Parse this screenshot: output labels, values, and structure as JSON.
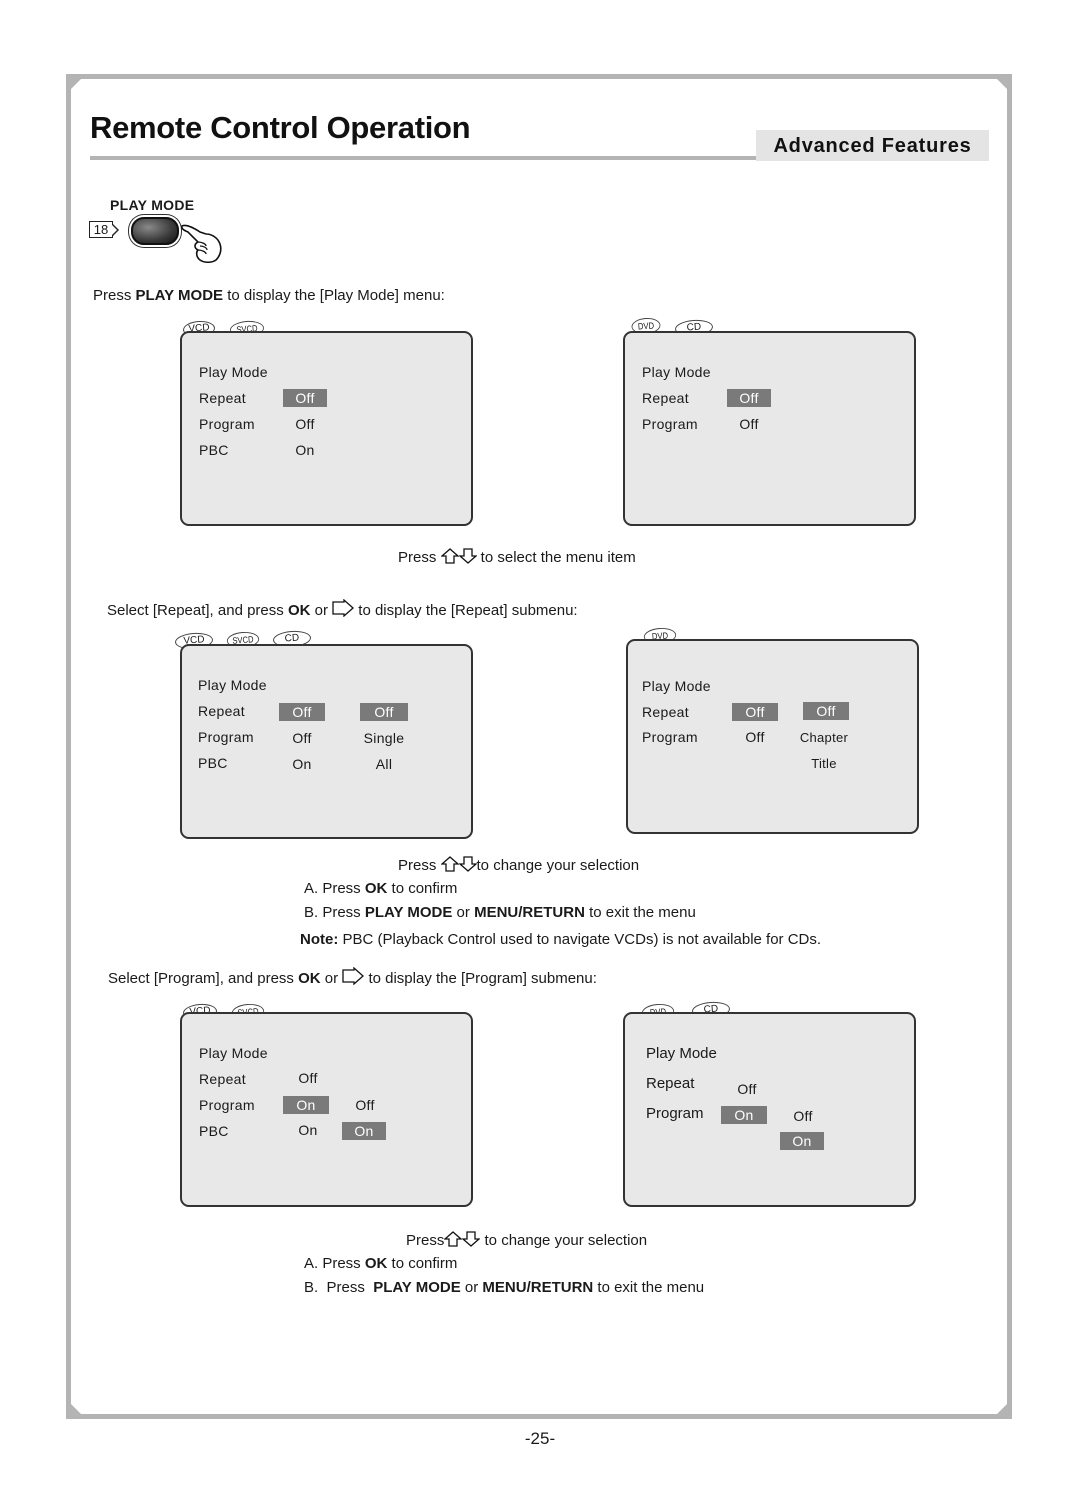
{
  "header": {
    "title": "Remote Control Operation",
    "section": "Advanced Features"
  },
  "button": {
    "label": "PLAY MODE",
    "key_number": "18"
  },
  "step1": {
    "pre": "Press ",
    "bold": "PLAY MODE",
    "post": " to display the [Play Mode] menu:"
  },
  "menus_main": {
    "left": {
      "tabs": [
        "VCD",
        "SVCD"
      ],
      "title": "Play Mode",
      "rows": [
        {
          "label": "Repeat",
          "value": "Off",
          "selected": true
        },
        {
          "label": "Program",
          "value": "Off"
        },
        {
          "label": "PBC",
          "value": "On"
        }
      ]
    },
    "right": {
      "tabs": [
        "DVD",
        "CD"
      ],
      "title": "Play Mode",
      "rows": [
        {
          "label": "Repeat",
          "value": "Off",
          "selected": true
        },
        {
          "label": "Program",
          "value": "Off"
        }
      ]
    }
  },
  "hint_select": {
    "pre": "Press",
    "post": " to select the menu item"
  },
  "step2": {
    "pre": "Select [Repeat], and press ",
    "bold": "OK",
    "mid": " or ",
    "post": " to display the [Repeat] submenu:"
  },
  "menus_repeat": {
    "left": {
      "tabs": [
        "VCD",
        "SVCD",
        "CD"
      ],
      "title": "Play Mode",
      "rows": [
        {
          "label": "Repeat",
          "value": "Off"
        },
        {
          "label": "Program",
          "value": "Off"
        },
        {
          "label": "PBC",
          "value": "On"
        }
      ],
      "submenu": [
        "Off",
        "Single",
        "All"
      ],
      "submenu_selected": "Off"
    },
    "right": {
      "tabs": [
        "DVD"
      ],
      "title": "Play Mode",
      "rows": [
        {
          "label": "Repeat",
          "value": "Off"
        },
        {
          "label": "Program",
          "value": "Off"
        }
      ],
      "submenu": [
        "Off",
        "Chapter",
        "Title"
      ],
      "submenu_selected": "Off"
    }
  },
  "instructions_repeat": {
    "change_pre": "Press",
    "change_post": "to change your selection",
    "a_prefix": "A.  Press ",
    "a_bold": "OK",
    "a_post": " to confirm",
    "b_prefix": "B.  Press ",
    "b_bold1": "PLAY MODE",
    "b_mid": " or ",
    "b_bold2": "MENU/RETURN",
    "b_post": " to exit the menu",
    "note_label": "Note:",
    "note_text": " PBC (Playback Control used to navigate VCDs) is not available for CDs."
  },
  "step3": {
    "pre": "Select [Program], and press ",
    "bold": "OK",
    "mid": " or ",
    "post": " to display the [Program] submenu:"
  },
  "menus_program": {
    "left": {
      "tabs": [
        "VCD",
        "SVCD"
      ],
      "title": "Play Mode",
      "rows": [
        {
          "label": "Repeat",
          "value": "Off"
        },
        {
          "label": "Program",
          "value": "On",
          "selected": true
        },
        {
          "label": "PBC",
          "value": "On"
        }
      ],
      "submenu": [
        "Off",
        "On"
      ],
      "submenu_selected": "On"
    },
    "right": {
      "tabs": [
        "DVD",
        "CD"
      ],
      "title": "Play Mode",
      "rows": [
        {
          "label": "Repeat",
          "value": "Off"
        },
        {
          "label": "Program",
          "value": "On",
          "selected": true
        }
      ],
      "submenu": [
        "Off",
        "On"
      ],
      "submenu_selected": "On"
    }
  },
  "instructions_program": {
    "change_pre": "Press",
    "change_post": " to change your selection",
    "a_prefix": "A.  Press ",
    "a_bold": "OK",
    "a_post": " to confirm",
    "b_prefix": "B.  Press  ",
    "b_bold1": "PLAY MODE",
    "b_mid": " or ",
    "b_bold2": "MENU/RETURN",
    "b_post": " to exit the menu"
  },
  "footer": {
    "page_number": "-25-"
  },
  "colors": {
    "frame": "#b4b4b4",
    "badge_bg": "#e4e4e4",
    "panel_bg": "#e8e8e8",
    "highlight": "#7a7a7a"
  }
}
